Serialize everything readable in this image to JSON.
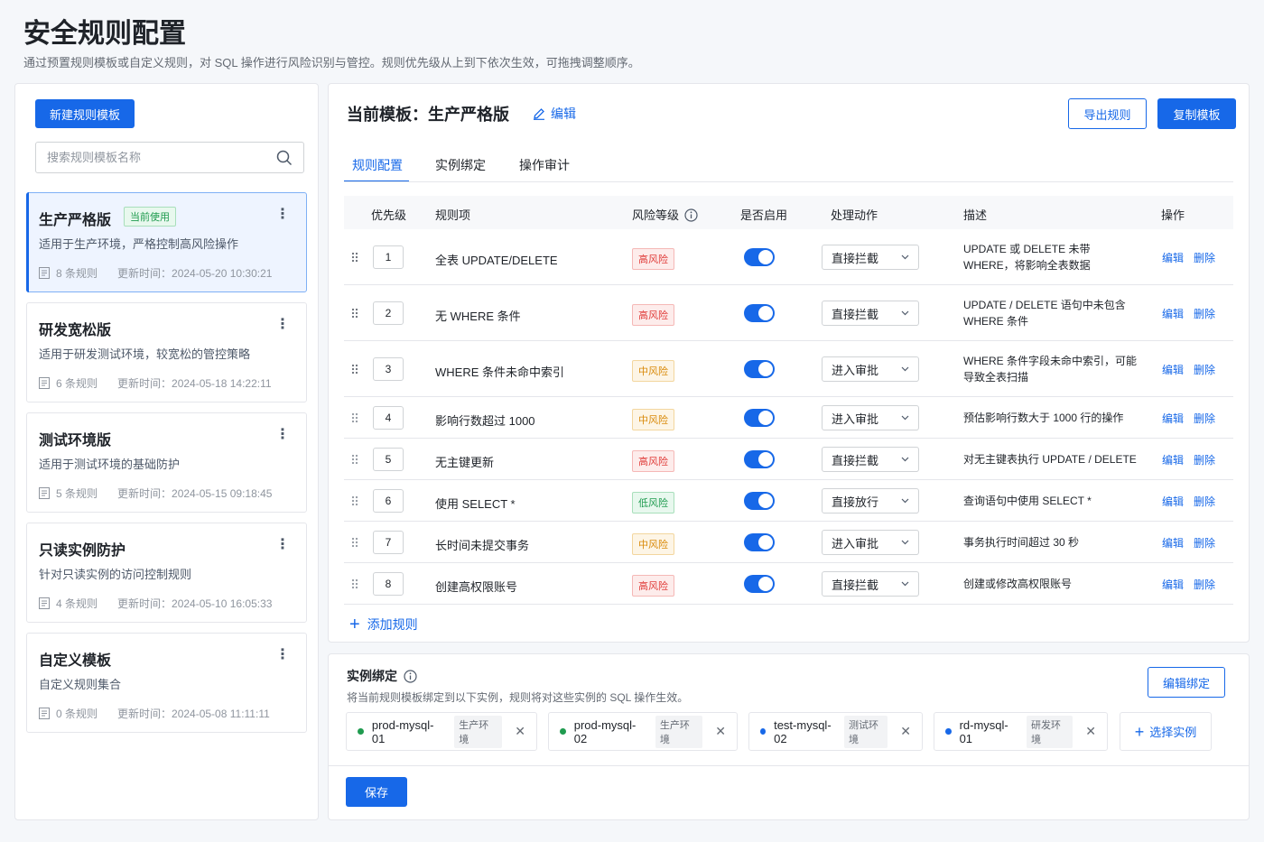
{
  "page": {
    "title": "安全规则配置",
    "description": "通过预置规则模板或自定义规则，对 SQL 操作进行风险识别与管控。规则优先级从上到下依次生效，可拖拽调整顺序。"
  },
  "sidebar": {
    "new_button": "新建规则模板",
    "search_placeholder": "搜索规则模板名称",
    "templates": [
      {
        "name": "生产严格版",
        "badge": "当前使用",
        "desc": "适用于生产环境，严格控制高风险操作",
        "count": "8 条规则",
        "updated": "更新时间：2024-05-20 10:30:21"
      },
      {
        "name": "研发宽松版",
        "desc": "适用于研发测试环境，较宽松的管控策略",
        "count": "6 条规则",
        "updated": "更新时间：2024-05-18 14:22:11"
      },
      {
        "name": "测试环境版",
        "desc": "适用于测试环境的基础防护",
        "count": "5 条规则",
        "updated": "更新时间：2024-05-15 09:18:45"
      },
      {
        "name": "只读实例防护",
        "desc": "针对只读实例的访问控制规则",
        "count": "4 条规则",
        "updated": "更新时间：2024-05-10 16:05:33"
      },
      {
        "name": "自定义模板",
        "desc": "自定义规则集合",
        "count": "0 条规则",
        "updated": "更新时间：2024-05-08 11:11:11"
      }
    ]
  },
  "main": {
    "current_title": "当前模板：生产严格版",
    "edit_label": "编辑",
    "export_label": "导出规则",
    "copy_label": "复制模板",
    "tabs": [
      "规则配置",
      "实例绑定",
      "操作审计"
    ],
    "columns": [
      "优先级",
      "规则项",
      "风险等级",
      "是否启用",
      "处理动作",
      "描述",
      "操作"
    ],
    "op_edit": "编辑",
    "op_delete": "删除",
    "rules": [
      {
        "prio": "1",
        "name": "全表 UPDATE/DELETE",
        "risk": "高风险",
        "level": "high",
        "action": "直接拦截",
        "desc": "UPDATE 或 DELETE 未带 WHERE，将影响全表数据",
        "enabled": true
      },
      {
        "prio": "2",
        "name": "无 WHERE 条件",
        "risk": "高风险",
        "level": "high",
        "action": "直接拦截",
        "desc": "UPDATE / DELETE 语句中未包含 WHERE 条件",
        "enabled": true
      },
      {
        "prio": "3",
        "name": "WHERE 条件未命中索引",
        "risk": "中风险",
        "level": "mid",
        "action": "进入审批",
        "desc": "WHERE 条件字段未命中索引，可能导致全表扫描",
        "enabled": true
      },
      {
        "prio": "4",
        "name": "影响行数超过 1000",
        "risk": "中风险",
        "level": "mid",
        "action": "进入审批",
        "desc": "预估影响行数大于 1000 行的操作",
        "enabled": true
      },
      {
        "prio": "5",
        "name": "无主键更新",
        "risk": "高风险",
        "level": "high",
        "action": "直接拦截",
        "desc": "对无主键表执行 UPDATE / DELETE",
        "enabled": true
      },
      {
        "prio": "6",
        "name": "使用 SELECT *",
        "risk": "低风险",
        "level": "low",
        "action": "直接放行",
        "desc": "查询语句中使用 SELECT *",
        "enabled": true
      },
      {
        "prio": "7",
        "name": "长时间未提交事务",
        "risk": "中风险",
        "level": "mid",
        "action": "进入审批",
        "desc": "事务执行时间超过 30 秒",
        "enabled": true
      },
      {
        "prio": "8",
        "name": "创建高权限账号",
        "risk": "高风险",
        "level": "high",
        "action": "直接拦截",
        "desc": "创建或修改高权限账号",
        "enabled": true
      }
    ],
    "add_rule": "添加规则"
  },
  "binding": {
    "title": "实例绑定",
    "desc": "将当前规则模板绑定到以下实例，规则将对这些实例的 SQL 操作生效。",
    "edit_button": "编辑绑定",
    "instances": [
      {
        "name": "prod-mysql-01",
        "env": "生产环境",
        "color": "#1f9b4f"
      },
      {
        "name": "prod-mysql-02",
        "env": "生产环境",
        "color": "#1f9b4f"
      },
      {
        "name": "test-mysql-02",
        "env": "测试环境",
        "color": "#1768e8"
      },
      {
        "name": "rd-mysql-01",
        "env": "研发环境",
        "color": "#1768e8"
      }
    ],
    "choose_label": "选择实例",
    "save_label": "保存"
  },
  "colors": {
    "accent": "#1768e8",
    "high": "#e03c39",
    "mid": "#d98a0a",
    "low": "#1f9b4f"
  }
}
